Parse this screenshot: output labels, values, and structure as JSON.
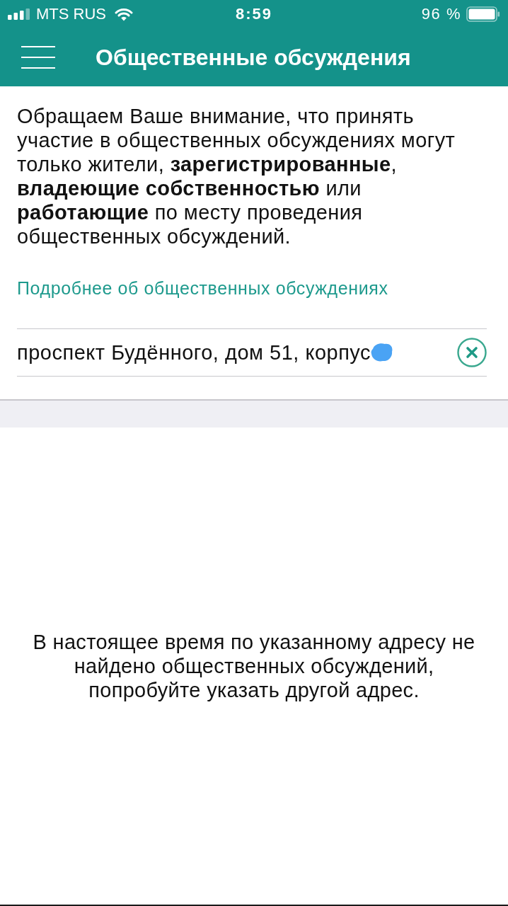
{
  "status_bar": {
    "carrier": "MTS RUS",
    "time": "8:59",
    "battery": "96 %"
  },
  "nav_bar": {
    "title": "Общественные обсуждения"
  },
  "notice": "Обращаем Ваше внимание, что принять участие в общественных обсуждениях могут только жители, **зарегистрированные**, **владеющие собственностью** или **работающие** по месту проведения общественных обсуждений.",
  "more_link": "Подробнее об общественных обсуждениях",
  "address_field": {
    "value": "проспект Будённого, дом 51, корпус"
  },
  "empty_message": "В настоящее время по указанному адресу не найдено общественных обсуждений, попробуйте указать другой адрес."
}
